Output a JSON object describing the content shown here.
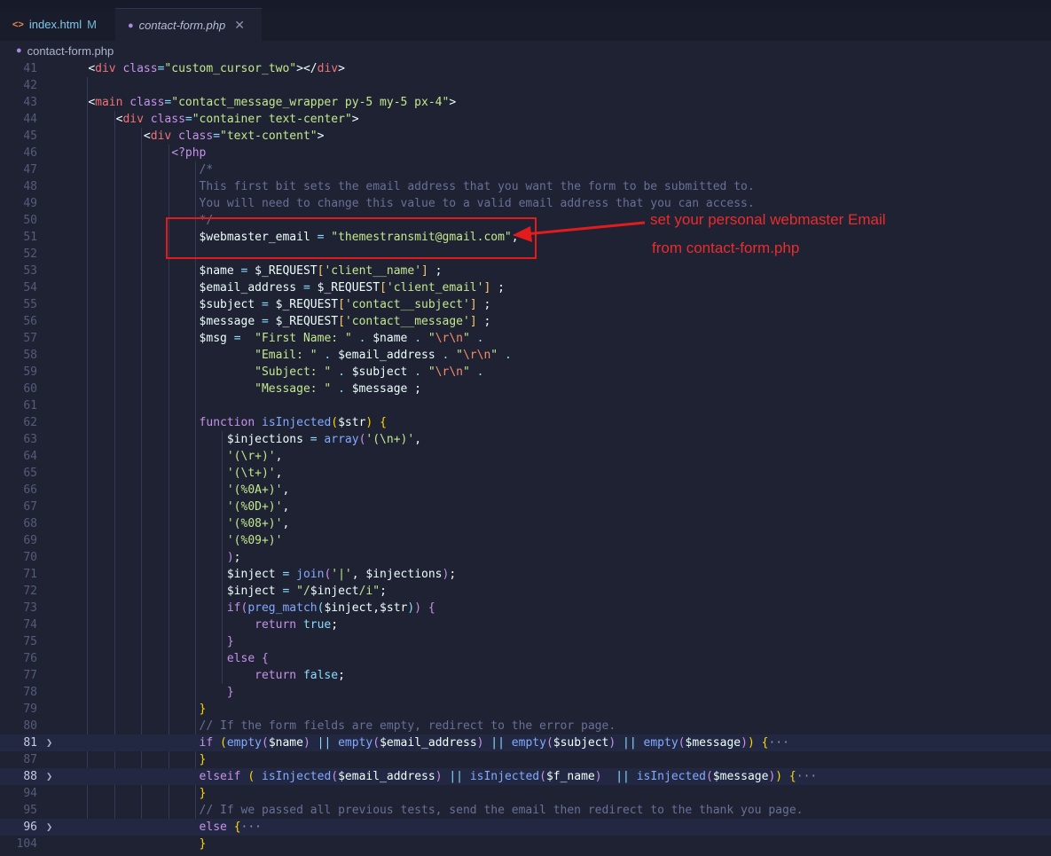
{
  "tabs": [
    {
      "icon": "html-tag-icon",
      "label": "index.html",
      "status": "M"
    },
    {
      "icon": "php-elephant-icon",
      "label": "contact-form.php",
      "close": "✕"
    }
  ],
  "breadcrumb": {
    "file": "contact-form.php"
  },
  "annotation": {
    "line1": "set your personal  webmaster Email",
    "line2": "from contact-form.php",
    "color": "#e21c1c"
  },
  "lines": [
    {
      "n": "41",
      "tokens": [
        [
          "d",
          "    "
        ],
        [
          "v",
          "<"
        ],
        [
          "t",
          "div"
        ],
        [
          "a",
          " class"
        ],
        [
          "p",
          "="
        ],
        [
          "s",
          "\"custom_cursor_two\""
        ],
        [
          "v",
          "></"
        ],
        [
          "t",
          "div"
        ],
        [
          "v",
          ">"
        ]
      ]
    },
    {
      "n": "42",
      "tokens": []
    },
    {
      "n": "43",
      "tokens": [
        [
          "d",
          "    "
        ],
        [
          "v",
          "<"
        ],
        [
          "t",
          "main"
        ],
        [
          "a",
          " class"
        ],
        [
          "p",
          "="
        ],
        [
          "s",
          "\"contact_message_wrapper py-5 my-5 px-4\""
        ],
        [
          "v",
          ">"
        ]
      ]
    },
    {
      "n": "44",
      "tokens": [
        [
          "d",
          "        "
        ],
        [
          "v",
          "<"
        ],
        [
          "t",
          "div"
        ],
        [
          "a",
          " class"
        ],
        [
          "p",
          "="
        ],
        [
          "s",
          "\"container text-center\""
        ],
        [
          "v",
          ">"
        ]
      ]
    },
    {
      "n": "45",
      "tokens": [
        [
          "d",
          "            "
        ],
        [
          "v",
          "<"
        ],
        [
          "t",
          "div"
        ],
        [
          "a",
          " class"
        ],
        [
          "p",
          "="
        ],
        [
          "s",
          "\"text-content\""
        ],
        [
          "v",
          ">"
        ]
      ]
    },
    {
      "n": "46",
      "tokens": [
        [
          "d",
          "                "
        ],
        [
          "k",
          "<?php"
        ]
      ]
    },
    {
      "n": "47",
      "tokens": [
        [
          "d",
          "                    "
        ],
        [
          "c",
          "/*"
        ]
      ]
    },
    {
      "n": "48",
      "tokens": [
        [
          "d",
          "                    "
        ],
        [
          "c",
          "This first bit sets the email address that you want the form to be submitted to."
        ]
      ]
    },
    {
      "n": "49",
      "tokens": [
        [
          "d",
          "                    "
        ],
        [
          "c",
          "You will need to change this value to a valid email address that you can access."
        ]
      ]
    },
    {
      "n": "50",
      "tokens": [
        [
          "d",
          "                    "
        ],
        [
          "c",
          "*/"
        ]
      ]
    },
    {
      "n": "51",
      "tokens": [
        [
          "d",
          "                    "
        ],
        [
          "v",
          "$webmaster_email "
        ],
        [
          "p",
          "="
        ],
        [
          "d",
          " "
        ],
        [
          "s",
          "\"themestransmit@gmail.com\""
        ],
        [
          "v",
          ";"
        ]
      ]
    },
    {
      "n": "52",
      "tokens": []
    },
    {
      "n": "53",
      "tokens": [
        [
          "d",
          "                    "
        ],
        [
          "v",
          "$name "
        ],
        [
          "p",
          "="
        ],
        [
          "v",
          " $_REQUEST"
        ],
        [
          "b",
          "["
        ],
        [
          "s",
          "'client__name'"
        ],
        [
          "b",
          "]"
        ],
        [
          "v",
          " ;"
        ]
      ]
    },
    {
      "n": "54",
      "tokens": [
        [
          "d",
          "                    "
        ],
        [
          "v",
          "$email_address "
        ],
        [
          "p",
          "="
        ],
        [
          "v",
          " $_REQUEST"
        ],
        [
          "b",
          "["
        ],
        [
          "s",
          "'client_email'"
        ],
        [
          "b",
          "]"
        ],
        [
          "v",
          " ;"
        ]
      ]
    },
    {
      "n": "55",
      "tokens": [
        [
          "d",
          "                    "
        ],
        [
          "v",
          "$subject "
        ],
        [
          "p",
          "="
        ],
        [
          "v",
          " $_REQUEST"
        ],
        [
          "b",
          "["
        ],
        [
          "s",
          "'contact__subject'"
        ],
        [
          "b",
          "]"
        ],
        [
          "v",
          " ;"
        ]
      ]
    },
    {
      "n": "56",
      "tokens": [
        [
          "d",
          "                    "
        ],
        [
          "v",
          "$message "
        ],
        [
          "p",
          "="
        ],
        [
          "v",
          " $_REQUEST"
        ],
        [
          "b",
          "["
        ],
        [
          "s",
          "'contact__message'"
        ],
        [
          "b",
          "]"
        ],
        [
          "v",
          " ;"
        ]
      ]
    },
    {
      "n": "57",
      "tokens": [
        [
          "d",
          "                    "
        ],
        [
          "v",
          "$msg "
        ],
        [
          "p",
          "="
        ],
        [
          "d",
          "  "
        ],
        [
          "s",
          "\"First Name: \""
        ],
        [
          "p",
          " . "
        ],
        [
          "v",
          "$name"
        ],
        [
          "p",
          " . "
        ],
        [
          "s",
          "\""
        ],
        [
          "n",
          "\\r\\n"
        ],
        [
          "s",
          "\""
        ],
        [
          "p",
          " ."
        ]
      ]
    },
    {
      "n": "58",
      "tokens": [
        [
          "d",
          "                            "
        ],
        [
          "s",
          "\"Email: \""
        ],
        [
          "p",
          " . "
        ],
        [
          "v",
          "$email_address"
        ],
        [
          "p",
          " . "
        ],
        [
          "s",
          "\""
        ],
        [
          "n",
          "\\r\\n"
        ],
        [
          "s",
          "\""
        ],
        [
          "p",
          " ."
        ]
      ]
    },
    {
      "n": "59",
      "tokens": [
        [
          "d",
          "                            "
        ],
        [
          "s",
          "\"Subject: \""
        ],
        [
          "p",
          " . "
        ],
        [
          "v",
          "$subject"
        ],
        [
          "p",
          " . "
        ],
        [
          "s",
          "\""
        ],
        [
          "n",
          "\\r\\n"
        ],
        [
          "s",
          "\""
        ],
        [
          "p",
          " ."
        ]
      ]
    },
    {
      "n": "60",
      "tokens": [
        [
          "d",
          "                            "
        ],
        [
          "s",
          "\"Message: \""
        ],
        [
          "p",
          " . "
        ],
        [
          "v",
          "$message ;"
        ]
      ]
    },
    {
      "n": "61",
      "tokens": []
    },
    {
      "n": "62",
      "tokens": [
        [
          "d",
          "                    "
        ],
        [
          "k",
          "function "
        ],
        [
          "f",
          "isInjected"
        ],
        [
          "g",
          "("
        ],
        [
          "v",
          "$str"
        ],
        [
          "g",
          ")"
        ],
        [
          "v",
          " "
        ],
        [
          "g",
          "{"
        ]
      ]
    },
    {
      "n": "63",
      "tokens": [
        [
          "d",
          "                        "
        ],
        [
          "v",
          "$injections "
        ],
        [
          "p",
          "="
        ],
        [
          "d",
          " "
        ],
        [
          "f",
          "array"
        ],
        [
          "a",
          "("
        ],
        [
          "s",
          "'(\\n+)'"
        ],
        [
          "v",
          ","
        ]
      ]
    },
    {
      "n": "64",
      "tokens": [
        [
          "d",
          "                        "
        ],
        [
          "s",
          "'(\\r+)'"
        ],
        [
          "v",
          ","
        ]
      ]
    },
    {
      "n": "65",
      "tokens": [
        [
          "d",
          "                        "
        ],
        [
          "s",
          "'(\\t+)'"
        ],
        [
          "v",
          ","
        ]
      ]
    },
    {
      "n": "66",
      "tokens": [
        [
          "d",
          "                        "
        ],
        [
          "s",
          "'(%0A+)'"
        ],
        [
          "v",
          ","
        ]
      ]
    },
    {
      "n": "67",
      "tokens": [
        [
          "d",
          "                        "
        ],
        [
          "s",
          "'(%0D+)'"
        ],
        [
          "v",
          ","
        ]
      ]
    },
    {
      "n": "68",
      "tokens": [
        [
          "d",
          "                        "
        ],
        [
          "s",
          "'(%08+)'"
        ],
        [
          "v",
          ","
        ]
      ]
    },
    {
      "n": "69",
      "tokens": [
        [
          "d",
          "                        "
        ],
        [
          "s",
          "'(%09+)'"
        ]
      ]
    },
    {
      "n": "70",
      "tokens": [
        [
          "d",
          "                        "
        ],
        [
          "a",
          ")"
        ],
        [
          "v",
          ";"
        ]
      ]
    },
    {
      "n": "71",
      "tokens": [
        [
          "d",
          "                        "
        ],
        [
          "v",
          "$inject "
        ],
        [
          "p",
          "="
        ],
        [
          "d",
          " "
        ],
        [
          "f",
          "join"
        ],
        [
          "a",
          "("
        ],
        [
          "s",
          "'|'"
        ],
        [
          "v",
          ", $injections"
        ],
        [
          "a",
          ")"
        ],
        [
          "v",
          ";"
        ]
      ]
    },
    {
      "n": "72",
      "tokens": [
        [
          "d",
          "                        "
        ],
        [
          "v",
          "$inject "
        ],
        [
          "p",
          "="
        ],
        [
          "d",
          " "
        ],
        [
          "s",
          "\"/"
        ],
        [
          "v",
          "$inject"
        ],
        [
          "s",
          "/i\""
        ],
        [
          "v",
          ";"
        ]
      ]
    },
    {
      "n": "73",
      "tokens": [
        [
          "d",
          "                        "
        ],
        [
          "k",
          "if"
        ],
        [
          "a",
          "("
        ],
        [
          "f",
          "preg_match"
        ],
        [
          "p",
          "("
        ],
        [
          "v",
          "$inject,$str"
        ],
        [
          "p",
          ")"
        ],
        [
          "a",
          ")"
        ],
        [
          "v",
          " "
        ],
        [
          "a",
          "{"
        ]
      ]
    },
    {
      "n": "74",
      "tokens": [
        [
          "d",
          "                            "
        ],
        [
          "k",
          "return "
        ],
        [
          "p",
          "true"
        ],
        [
          "v",
          ";"
        ]
      ]
    },
    {
      "n": "75",
      "tokens": [
        [
          "d",
          "                        "
        ],
        [
          "a",
          "}"
        ]
      ]
    },
    {
      "n": "76",
      "tokens": [
        [
          "d",
          "                        "
        ],
        [
          "k",
          "else "
        ],
        [
          "a",
          "{"
        ]
      ]
    },
    {
      "n": "77",
      "tokens": [
        [
          "d",
          "                            "
        ],
        [
          "k",
          "return "
        ],
        [
          "p",
          "false"
        ],
        [
          "v",
          ";"
        ]
      ]
    },
    {
      "n": "78",
      "tokens": [
        [
          "d",
          "                        "
        ],
        [
          "a",
          "}"
        ]
      ]
    },
    {
      "n": "79",
      "tokens": [
        [
          "d",
          "                    "
        ],
        [
          "g",
          "}"
        ]
      ]
    },
    {
      "n": "80",
      "tokens": [
        [
          "d",
          "                    "
        ],
        [
          "c",
          "// If the form fields are empty, redirect to the error page."
        ]
      ]
    },
    {
      "n": "81",
      "fold": true,
      "tokens": [
        [
          "d",
          "                    "
        ],
        [
          "k",
          "if "
        ],
        [
          "g",
          "("
        ],
        [
          "f",
          "empty"
        ],
        [
          "a",
          "("
        ],
        [
          "v",
          "$name"
        ],
        [
          "a",
          ")"
        ],
        [
          "p",
          " || "
        ],
        [
          "f",
          "empty"
        ],
        [
          "a",
          "("
        ],
        [
          "v",
          "$email_address"
        ],
        [
          "a",
          ")"
        ],
        [
          "p",
          " || "
        ],
        [
          "f",
          "empty"
        ],
        [
          "a",
          "("
        ],
        [
          "v",
          "$subject"
        ],
        [
          "a",
          ")"
        ],
        [
          "p",
          " || "
        ],
        [
          "f",
          "empty"
        ],
        [
          "a",
          "("
        ],
        [
          "v",
          "$message"
        ],
        [
          "a",
          ")"
        ],
        [
          "g",
          ")"
        ],
        [
          "v",
          " "
        ],
        [
          "g",
          "{"
        ],
        [
          "m",
          "···"
        ]
      ]
    },
    {
      "n": "87",
      "tokens": [
        [
          "d",
          "                    "
        ],
        [
          "g",
          "}"
        ]
      ]
    },
    {
      "n": "88",
      "fold": true,
      "tokens": [
        [
          "d",
          "                    "
        ],
        [
          "k",
          "elseif "
        ],
        [
          "g",
          "("
        ],
        [
          "d",
          " "
        ],
        [
          "f",
          "isInjected"
        ],
        [
          "a",
          "("
        ],
        [
          "v",
          "$email_address"
        ],
        [
          "a",
          ")"
        ],
        [
          "p",
          " || "
        ],
        [
          "f",
          "isInjected"
        ],
        [
          "a",
          "("
        ],
        [
          "v",
          "$f_name"
        ],
        [
          "a",
          ")"
        ],
        [
          "p",
          "  || "
        ],
        [
          "f",
          "isInjected"
        ],
        [
          "a",
          "("
        ],
        [
          "v",
          "$message"
        ],
        [
          "a",
          ")"
        ],
        [
          "g",
          ")"
        ],
        [
          "v",
          " "
        ],
        [
          "g",
          "{"
        ],
        [
          "m",
          "···"
        ]
      ]
    },
    {
      "n": "94",
      "tokens": [
        [
          "d",
          "                    "
        ],
        [
          "g",
          "}"
        ]
      ]
    },
    {
      "n": "95",
      "tokens": [
        [
          "d",
          "                    "
        ],
        [
          "c",
          "// If we passed all previous tests, send the email then redirect to the thank you page."
        ]
      ]
    },
    {
      "n": "96",
      "fold": true,
      "tokens": [
        [
          "d",
          "                    "
        ],
        [
          "k",
          "else "
        ],
        [
          "g",
          "{"
        ],
        [
          "m",
          "···"
        ]
      ]
    },
    {
      "n": "104",
      "tokens": [
        [
          "d",
          "                    "
        ],
        [
          "g",
          "}"
        ]
      ]
    }
  ]
}
